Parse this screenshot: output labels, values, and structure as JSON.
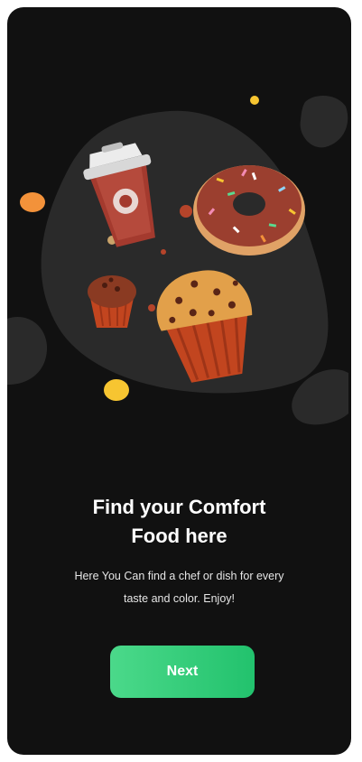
{
  "onboarding": {
    "title": "Find your  Comfort\nFood here",
    "subtitle": "Here You Can find a chef or dish for every taste and color. Enjoy!",
    "next_label": "Next"
  },
  "illustration": {
    "items": [
      "coffee-cup",
      "donut",
      "small-muffin",
      "large-muffin"
    ]
  },
  "colors": {
    "background": "#111111",
    "blob": "#2a2a2a",
    "button_start": "#4bd98a",
    "button_end": "#22c26d",
    "text": "#ffffff"
  }
}
